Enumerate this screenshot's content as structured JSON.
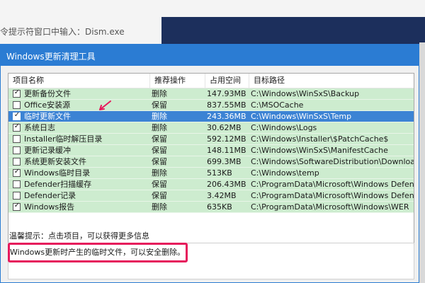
{
  "background": {
    "article_text": "令提示符窗口中输入：Dism.exe"
  },
  "window": {
    "title": "Windows更新清理工具"
  },
  "table": {
    "columns": [
      "项目名称",
      "推荐操作",
      "占用空间",
      "目标路径"
    ],
    "rows": [
      {
        "checked": true,
        "name": "更新备份文件",
        "action": "删除",
        "size": "147.93MB",
        "path": "C:\\Windows\\WinSxS\\Backup",
        "selected": false
      },
      {
        "checked": false,
        "name": "Office安装源",
        "action": "保留",
        "size": "837.55MB",
        "path": "C:\\MSOCache",
        "selected": false
      },
      {
        "checked": true,
        "name": "临时更新文件",
        "action": "删除",
        "size": "243.36MB",
        "path": "C:\\Windows\\WinSxS\\Temp",
        "selected": true
      },
      {
        "checked": true,
        "name": "系统日志",
        "action": "删除",
        "size": "30.62MB",
        "path": "C:\\Windows\\Logs",
        "selected": false
      },
      {
        "checked": false,
        "name": "Installer临时解压目录",
        "action": "保留",
        "size": "592.12MB",
        "path": "C:\\Windows\\Installer\\$PatchCache$",
        "selected": false
      },
      {
        "checked": false,
        "name": "更新记录缓冲",
        "action": "保留",
        "size": "148.11MB",
        "path": "C:\\Windows\\WinSxS\\ManifestCache",
        "selected": false
      },
      {
        "checked": false,
        "name": "系统更新安装文件",
        "action": "保留",
        "size": "699.3MB",
        "path": "C:\\Windows\\SoftwareDistribution\\Download",
        "selected": false
      },
      {
        "checked": true,
        "name": "Windows临时目录",
        "action": "删除",
        "size": "513KB",
        "path": "C:\\Windows\\temp",
        "selected": false
      },
      {
        "checked": false,
        "name": "Defender扫描缓存",
        "action": "保留",
        "size": "206.43MB",
        "path": "C:\\ProgramData\\Microsoft\\Windows Defender\\",
        "selected": false
      },
      {
        "checked": false,
        "name": "Defender记录",
        "action": "保留",
        "size": "3.42MB",
        "path": "C:\\ProgramData\\Microsoft\\Windows Defender\\",
        "selected": false
      },
      {
        "checked": true,
        "name": "Windows报告",
        "action": "删除",
        "size": "635KB",
        "path": "C:\\ProgramData\\Microsoft\\Windows\\WER",
        "selected": false
      }
    ]
  },
  "hint": "温馨提示：点击项目，可以获得更多信息",
  "description": "Windows更新时产生的临时文件，可以安全删除。",
  "colors": {
    "titlebar": "#2b7cd3",
    "row_bg": "#cdeccf",
    "selected_bg": "#3c83d4",
    "highlight": "#e6195c",
    "annotation_arrow": "#e6195c"
  }
}
